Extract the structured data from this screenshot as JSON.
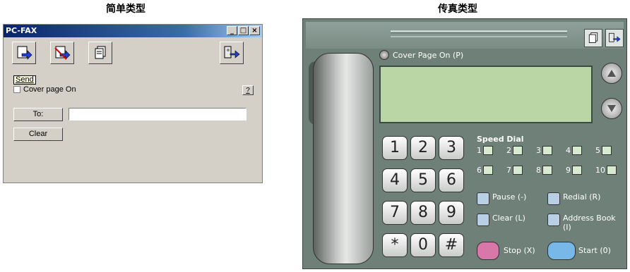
{
  "captions": {
    "simple": "简单类型",
    "fax": "传真类型"
  },
  "simple": {
    "title": "PC-FAX",
    "win_buttons": [
      "_",
      "□",
      "×"
    ],
    "tooltip": "Send",
    "cover_page_label": "Cover page On",
    "help": "?",
    "to_button": "To:",
    "clear_button": "Clear",
    "to_value": ""
  },
  "fax": {
    "cover_page": "Cover Page On (P)",
    "keys": [
      "1",
      "2",
      "3",
      "4",
      "5",
      "6",
      "7",
      "8",
      "9",
      "*",
      "0",
      "#"
    ],
    "speed_dial_title": "Speed Dial",
    "speed_dial": [
      "1",
      "2",
      "3",
      "4",
      "5",
      "6",
      "7",
      "8",
      "9",
      "10"
    ],
    "pause": "Pause (-)",
    "redial": "Redial (R)",
    "clear": "Clear (L)",
    "address_book_1": "Address Book",
    "address_book_2": "(I)",
    "stop": "Stop (X)",
    "start": "Start (0)"
  },
  "colors": {
    "lcd": "#b9d6a4",
    "stop": "#d878a8",
    "start": "#78b8e8",
    "panel": "#6e8077"
  }
}
